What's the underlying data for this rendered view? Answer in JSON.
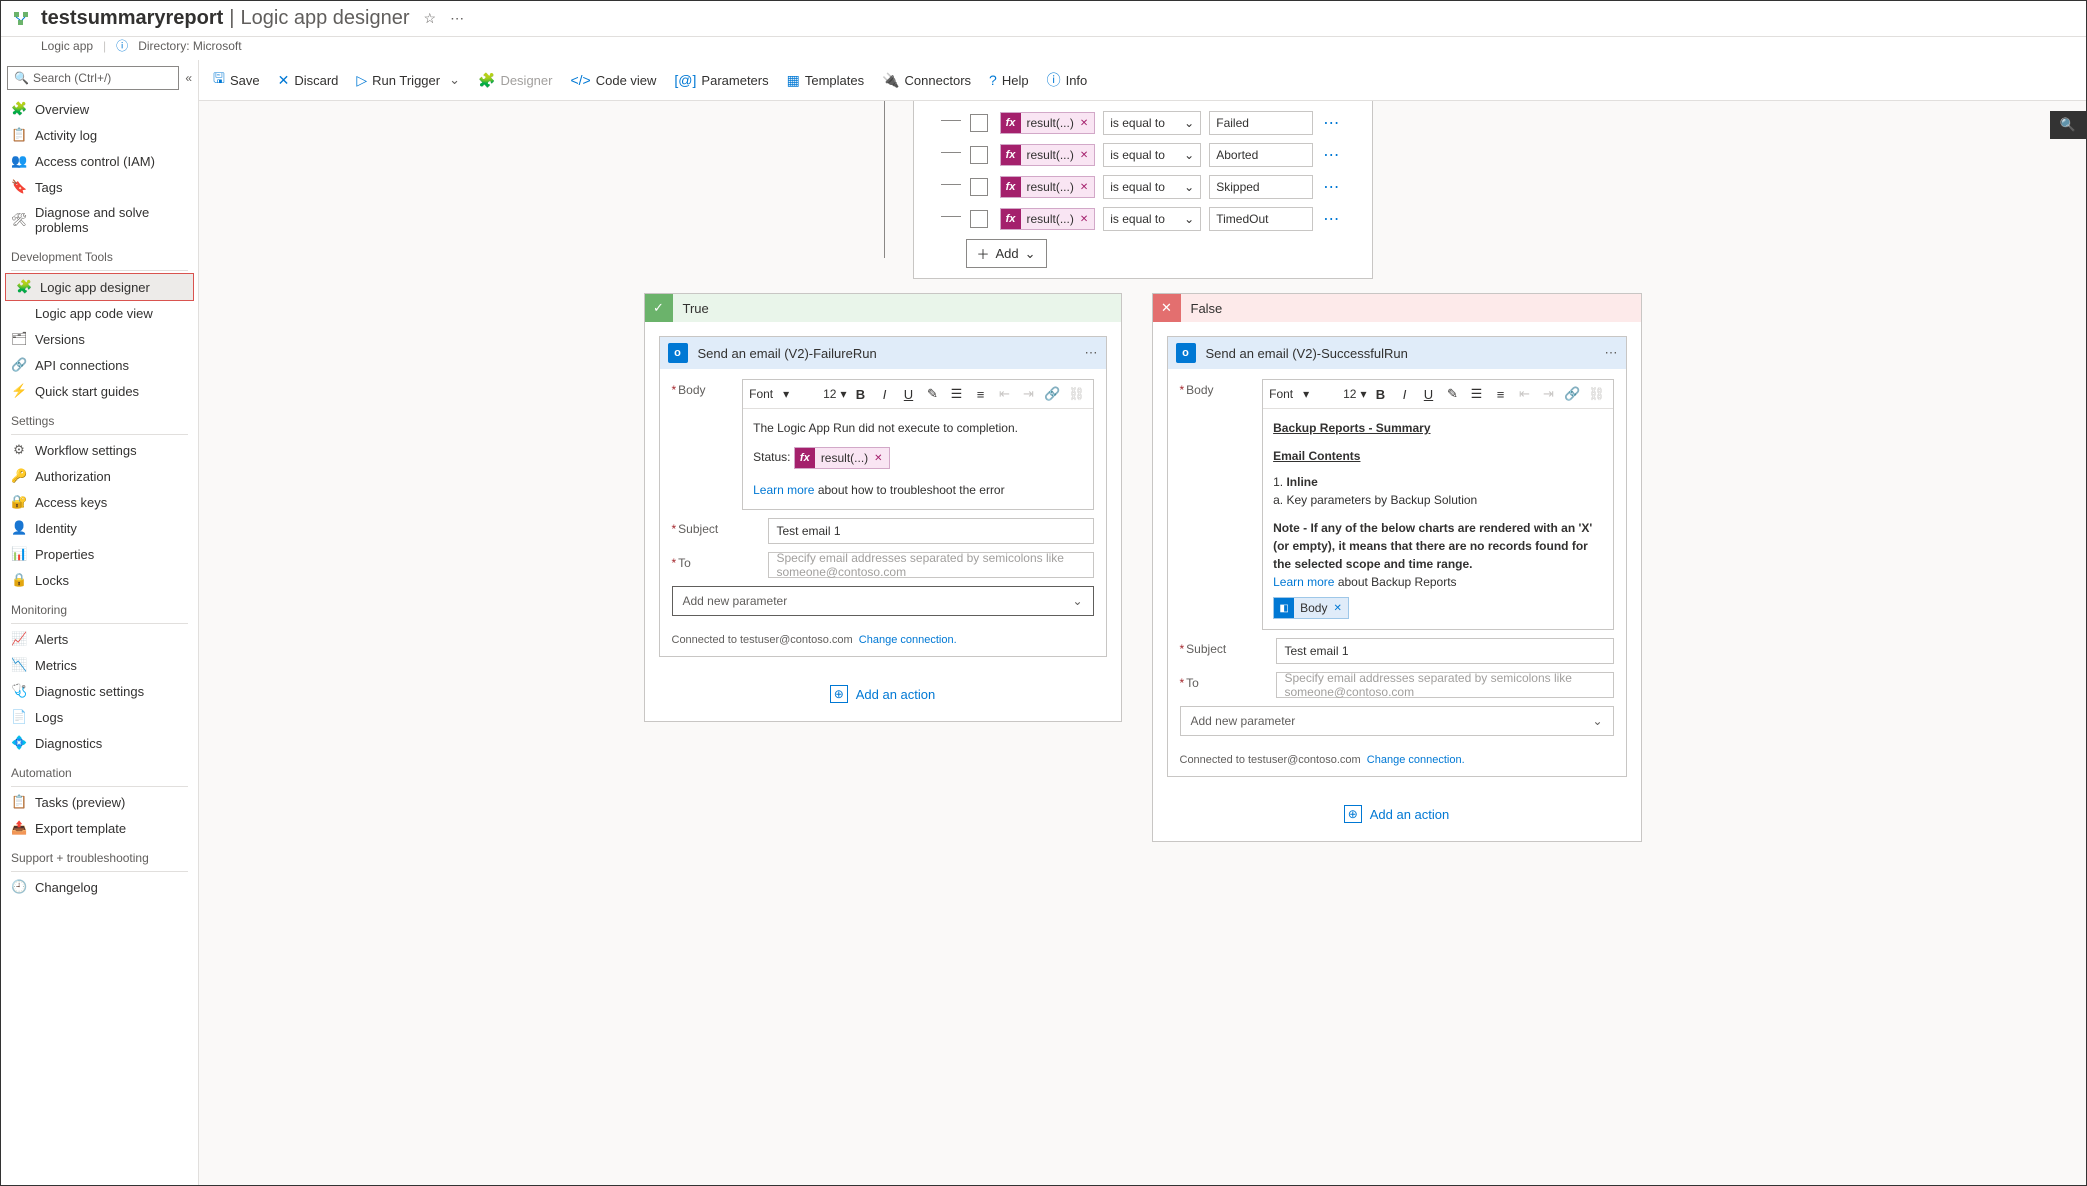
{
  "header": {
    "app_name": "testsummaryreport",
    "page_title": "Logic app designer",
    "resource_type": "Logic app",
    "directory_label": "Directory: Microsoft"
  },
  "search_placeholder": "Search (Ctrl+/)",
  "sidebar": {
    "items_top": [
      {
        "label": "Overview",
        "icon": "🧩",
        "color": "#6bb36b"
      },
      {
        "label": "Activity log",
        "icon": "📋",
        "color": "#605e5c"
      },
      {
        "label": "Access control (IAM)",
        "icon": "👥",
        "color": "#605e5c"
      },
      {
        "label": "Tags",
        "icon": "🔖",
        "color": "#8661c5"
      },
      {
        "label": "Diagnose and solve problems",
        "icon": "🛠",
        "color": "#605e5c"
      }
    ],
    "section_dev": "Development Tools",
    "items_dev": [
      {
        "label": "Logic app designer",
        "icon": "🧩",
        "color": "#6bb36b",
        "active": true
      },
      {
        "label": "Logic app code view",
        "icon": "</>",
        "color": "#605e5c"
      },
      {
        "label": "Versions",
        "icon": "🗂",
        "color": "#605e5c"
      },
      {
        "label": "API connections",
        "icon": "🔗",
        "color": "#6bb36b"
      },
      {
        "label": "Quick start guides",
        "icon": "⚡",
        "color": "#6bb36b"
      }
    ],
    "section_settings": "Settings",
    "items_settings": [
      {
        "label": "Workflow settings",
        "icon": "⚙",
        "color": "#605e5c"
      },
      {
        "label": "Authorization",
        "icon": "🔑",
        "color": "#d4a017"
      },
      {
        "label": "Access keys",
        "icon": "🔐",
        "color": "#0078d4"
      },
      {
        "label": "Identity",
        "icon": "👤",
        "color": "#d4a017"
      },
      {
        "label": "Properties",
        "icon": "📊",
        "color": "#0078d4"
      },
      {
        "label": "Locks",
        "icon": "🔒",
        "color": "#605e5c"
      }
    ],
    "section_monitoring": "Monitoring",
    "items_monitoring": [
      {
        "label": "Alerts",
        "icon": "📈",
        "color": "#6bb36b"
      },
      {
        "label": "Metrics",
        "icon": "📉",
        "color": "#0078d4"
      },
      {
        "label": "Diagnostic settings",
        "icon": "🩺",
        "color": "#6bb36b"
      },
      {
        "label": "Logs",
        "icon": "📄",
        "color": "#0078d4"
      },
      {
        "label": "Diagnostics",
        "icon": "💠",
        "color": "#0078d4"
      }
    ],
    "section_automation": "Automation",
    "items_automation": [
      {
        "label": "Tasks (preview)",
        "icon": "📋",
        "color": "#6bb36b"
      },
      {
        "label": "Export template",
        "icon": "📤",
        "color": "#0078d4"
      }
    ],
    "section_support": "Support + troubleshooting",
    "items_support": [
      {
        "label": "Changelog",
        "icon": "🕘",
        "color": "#8661c5"
      }
    ]
  },
  "toolbar": {
    "save": "Save",
    "discard": "Discard",
    "run": "Run Trigger",
    "designer": "Designer",
    "codeview": "Code view",
    "parameters": "Parameters",
    "templates": "Templates",
    "connectors": "Connectors",
    "help": "Help",
    "info": "Info"
  },
  "condition": {
    "chip": "result(...)",
    "op": "is equal to",
    "rows": [
      {
        "value": "Failed"
      },
      {
        "value": "Aborted"
      },
      {
        "value": "Skipped"
      },
      {
        "value": "TimedOut"
      }
    ],
    "add": "Add"
  },
  "branch_true": "True",
  "branch_false": "False",
  "true_card": {
    "title": "Send an email (V2)-FailureRun",
    "body_label": "Body",
    "font": "Font",
    "size": "12",
    "line1": "The Logic App Run did not execute to completion.",
    "status_label": "Status:",
    "status_chip": "result(...)",
    "learn": "Learn more",
    "learn_after": " about how to troubleshoot the error",
    "subject_label": "Subject",
    "subject_value": "Test email 1",
    "to_label": "To",
    "to_placeholder": "Specify email addresses separated by semicolons like someone@contoso.com",
    "add_param": "Add new parameter",
    "connected": "Connected to testuser@contoso.com",
    "change": "Change connection.",
    "add_action": "Add an action"
  },
  "false_card": {
    "title": "Send an email (V2)-SuccessfulRun",
    "body_label": "Body",
    "font": "Font",
    "size": "12",
    "heading1": "Backup Reports - Summary",
    "heading2": "Email Contents",
    "line_inline_n": "1. ",
    "line_inline": "Inline",
    "line_a": "a. Key parameters by Backup Solution",
    "note_label": "Note - ",
    "note": "If any of the below charts are rendered with an 'X' (or empty), it means that there are no records found for the selected scope and time range.",
    "learn": "Learn more",
    "learn_after": " about Backup Reports",
    "body_chip": "Body",
    "subject_label": "Subject",
    "subject_value": "Test email 1",
    "to_label": "To",
    "to_placeholder": "Specify email addresses separated by semicolons like someone@contoso.com",
    "add_param": "Add new parameter",
    "connected": "Connected to testuser@contoso.com",
    "change": "Change connection.",
    "add_action": "Add an action"
  }
}
